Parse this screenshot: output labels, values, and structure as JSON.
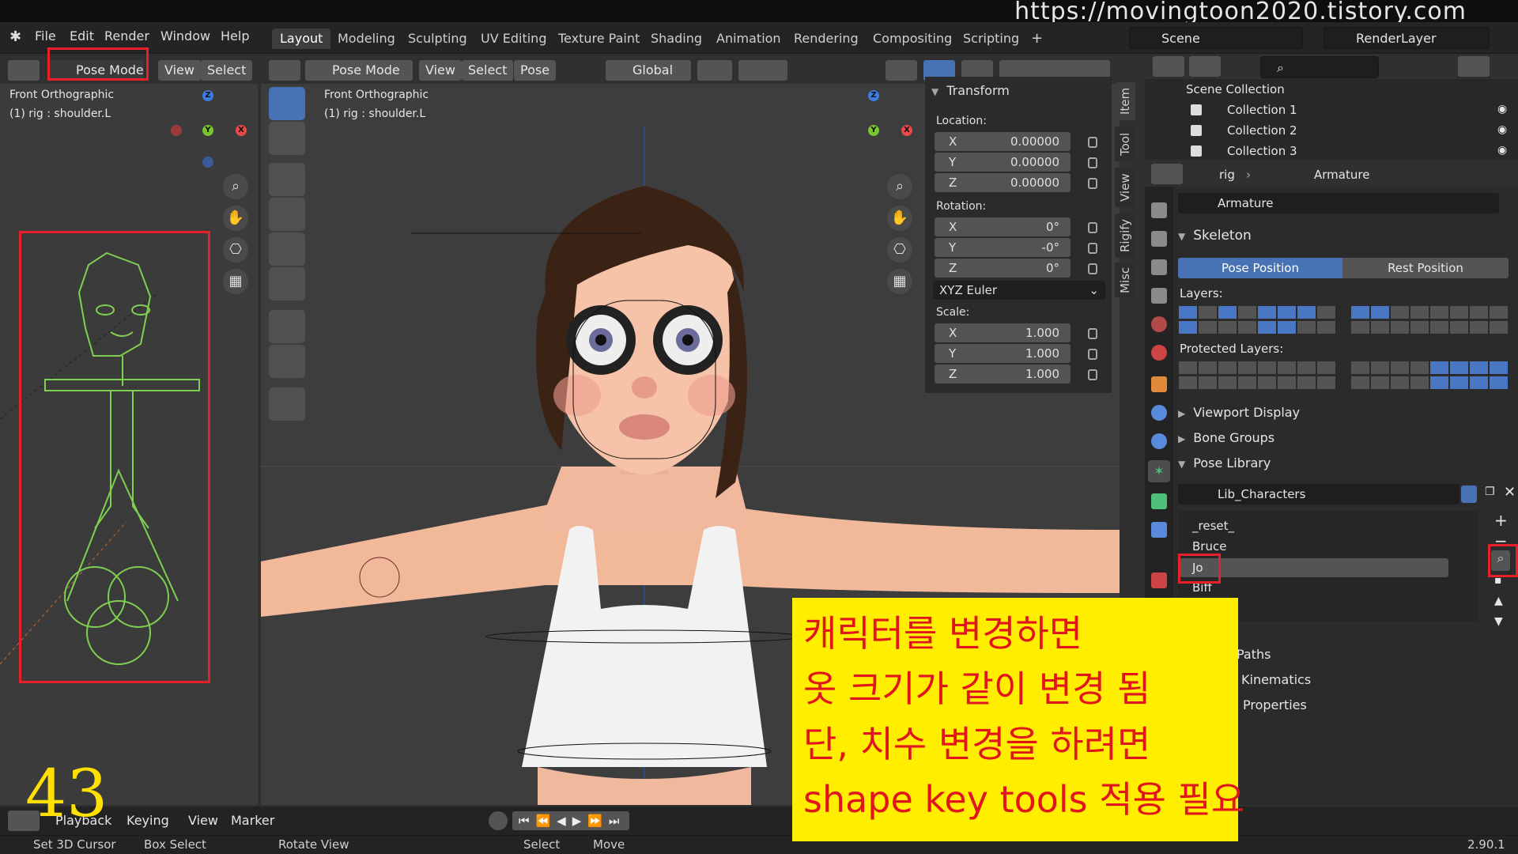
{
  "watermark": "https://movingtoon2020.tistory.com",
  "menu": {
    "file": "File",
    "edit": "Edit",
    "render": "Render",
    "window": "Window",
    "help": "Help"
  },
  "workspaces": [
    "Layout",
    "Modeling",
    "Sculpting",
    "UV Editing",
    "Texture Paint",
    "Shading",
    "Animation",
    "Rendering",
    "Compositing",
    "Scripting"
  ],
  "scene": {
    "name": "Scene",
    "render_layer": "RenderLayer"
  },
  "left_viewport": {
    "mode": "Pose Mode",
    "view": "View",
    "select": "Select",
    "overlay_line1": "Front Orthographic",
    "overlay_line2": "(1) rig : shoulder.L"
  },
  "main_viewport": {
    "mode": "Pose Mode",
    "view": "View",
    "select": "Select",
    "pose": "Pose",
    "orientation": "Global",
    "overlay_line1": "Front Orthographic",
    "overlay_line2": "(1) rig : shoulder.L"
  },
  "transform": {
    "title": "Transform",
    "location_label": "Location:",
    "location": [
      {
        "axis": "X",
        "value": "0.00000"
      },
      {
        "axis": "Y",
        "value": "0.00000"
      },
      {
        "axis": "Z",
        "value": "0.00000"
      }
    ],
    "rotation_label": "Rotation:",
    "rotation": [
      {
        "axis": "X",
        "value": "0°"
      },
      {
        "axis": "Y",
        "value": "-0°"
      },
      {
        "axis": "Z",
        "value": "0°"
      }
    ],
    "rotation_mode": "XYZ Euler",
    "scale_label": "Scale:",
    "scale": [
      {
        "axis": "X",
        "value": "1.000"
      },
      {
        "axis": "Y",
        "value": "1.000"
      },
      {
        "axis": "Z",
        "value": "1.000"
      }
    ]
  },
  "sidebar_tabs": [
    "Item",
    "Tool",
    "View",
    "Rigify",
    "Misc"
  ],
  "outliner": {
    "root": "Scene Collection",
    "collections": [
      "Collection 1",
      "Collection 2",
      "Collection 3"
    ]
  },
  "properties": {
    "breadcrumb_object": "rig",
    "breadcrumb_data": "Armature",
    "datablock": "Armature",
    "skeleton": "Skeleton",
    "pose_position": "Pose Position",
    "rest_position": "Rest Position",
    "layers_label": "Layers:",
    "protected_label": "Protected Layers:",
    "viewport_display": "Viewport Display",
    "bone_groups": "Bone Groups",
    "pose_library": "Pose Library",
    "library_name": "Lib_Characters",
    "poses": [
      "_reset_",
      "Bruce",
      "Jo",
      "Biff"
    ],
    "paths": "Paths",
    "kinematics": "Kinematics",
    "custom_properties": "Properties"
  },
  "timeline": {
    "playback": "Playback",
    "keying": "Keying",
    "view": "View",
    "marker": "Marker"
  },
  "status": {
    "set_cursor": "Set 3D Cursor",
    "box_select": "Box Select",
    "rotate_view": "Rotate View",
    "select": "Select",
    "move": "Move",
    "version": "2.90.1"
  },
  "annotation": {
    "lines": [
      "캐릭터를 변경하면",
      "옷 크기가 같이 변경 됨",
      "단, 치수 변경을 하려면",
      "shape key tools 적용 필요"
    ],
    "step_number": "43"
  },
  "colors": {
    "accent": "#4772b3",
    "highlight_red": "#e8202a",
    "note_bg": "#ffee00",
    "note_text": "#e0161c",
    "rig_green": "#7fd050"
  }
}
